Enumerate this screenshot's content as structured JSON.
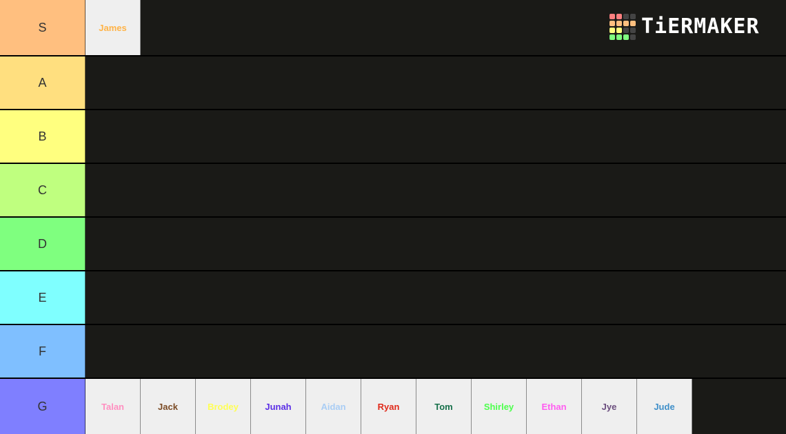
{
  "logo": {
    "text": "TiERMAKER",
    "grid_colors": [
      "#ff7f7f",
      "#ff7f7f",
      "#444444",
      "#444444",
      "#ffbf7f",
      "#ffbf7f",
      "#ffbf7f",
      "#ffbf7f",
      "#ffff7f",
      "#ffff7f",
      "#444444",
      "#444444",
      "#7fff7f",
      "#7fff7f",
      "#7fff7f",
      "#444444"
    ]
  },
  "tiers": [
    {
      "label": "S",
      "color": "#ffbf7f",
      "items": [
        {
          "name": "James",
          "color": "#ffb347"
        }
      ]
    },
    {
      "label": "A",
      "color": "#ffdf7f",
      "items": []
    },
    {
      "label": "B",
      "color": "#ffff7f",
      "items": []
    },
    {
      "label": "C",
      "color": "#bfff7f",
      "items": []
    },
    {
      "label": "D",
      "color": "#7fff7f",
      "items": []
    },
    {
      "label": "E",
      "color": "#7fffff",
      "items": []
    },
    {
      "label": "F",
      "color": "#7fbfff",
      "items": []
    },
    {
      "label": "G",
      "color": "#7f7fff",
      "items": [
        {
          "name": "Talan",
          "color": "#ff8fc0"
        },
        {
          "name": "Jack",
          "color": "#7a4a24"
        },
        {
          "name": "Brodey",
          "color": "#ffff55"
        },
        {
          "name": "Junah",
          "color": "#5a2de6"
        },
        {
          "name": "Aidan",
          "color": "#a9cdf5"
        },
        {
          "name": "Ryan",
          "color": "#e02a1a"
        },
        {
          "name": "Tom",
          "color": "#16704a"
        },
        {
          "name": "Shirley",
          "color": "#4dff4d"
        },
        {
          "name": "Ethan",
          "color": "#ff5cf0"
        },
        {
          "name": "Jye",
          "color": "#6b4e7e"
        },
        {
          "name": "Jude",
          "color": "#3f8fc9"
        }
      ]
    }
  ]
}
